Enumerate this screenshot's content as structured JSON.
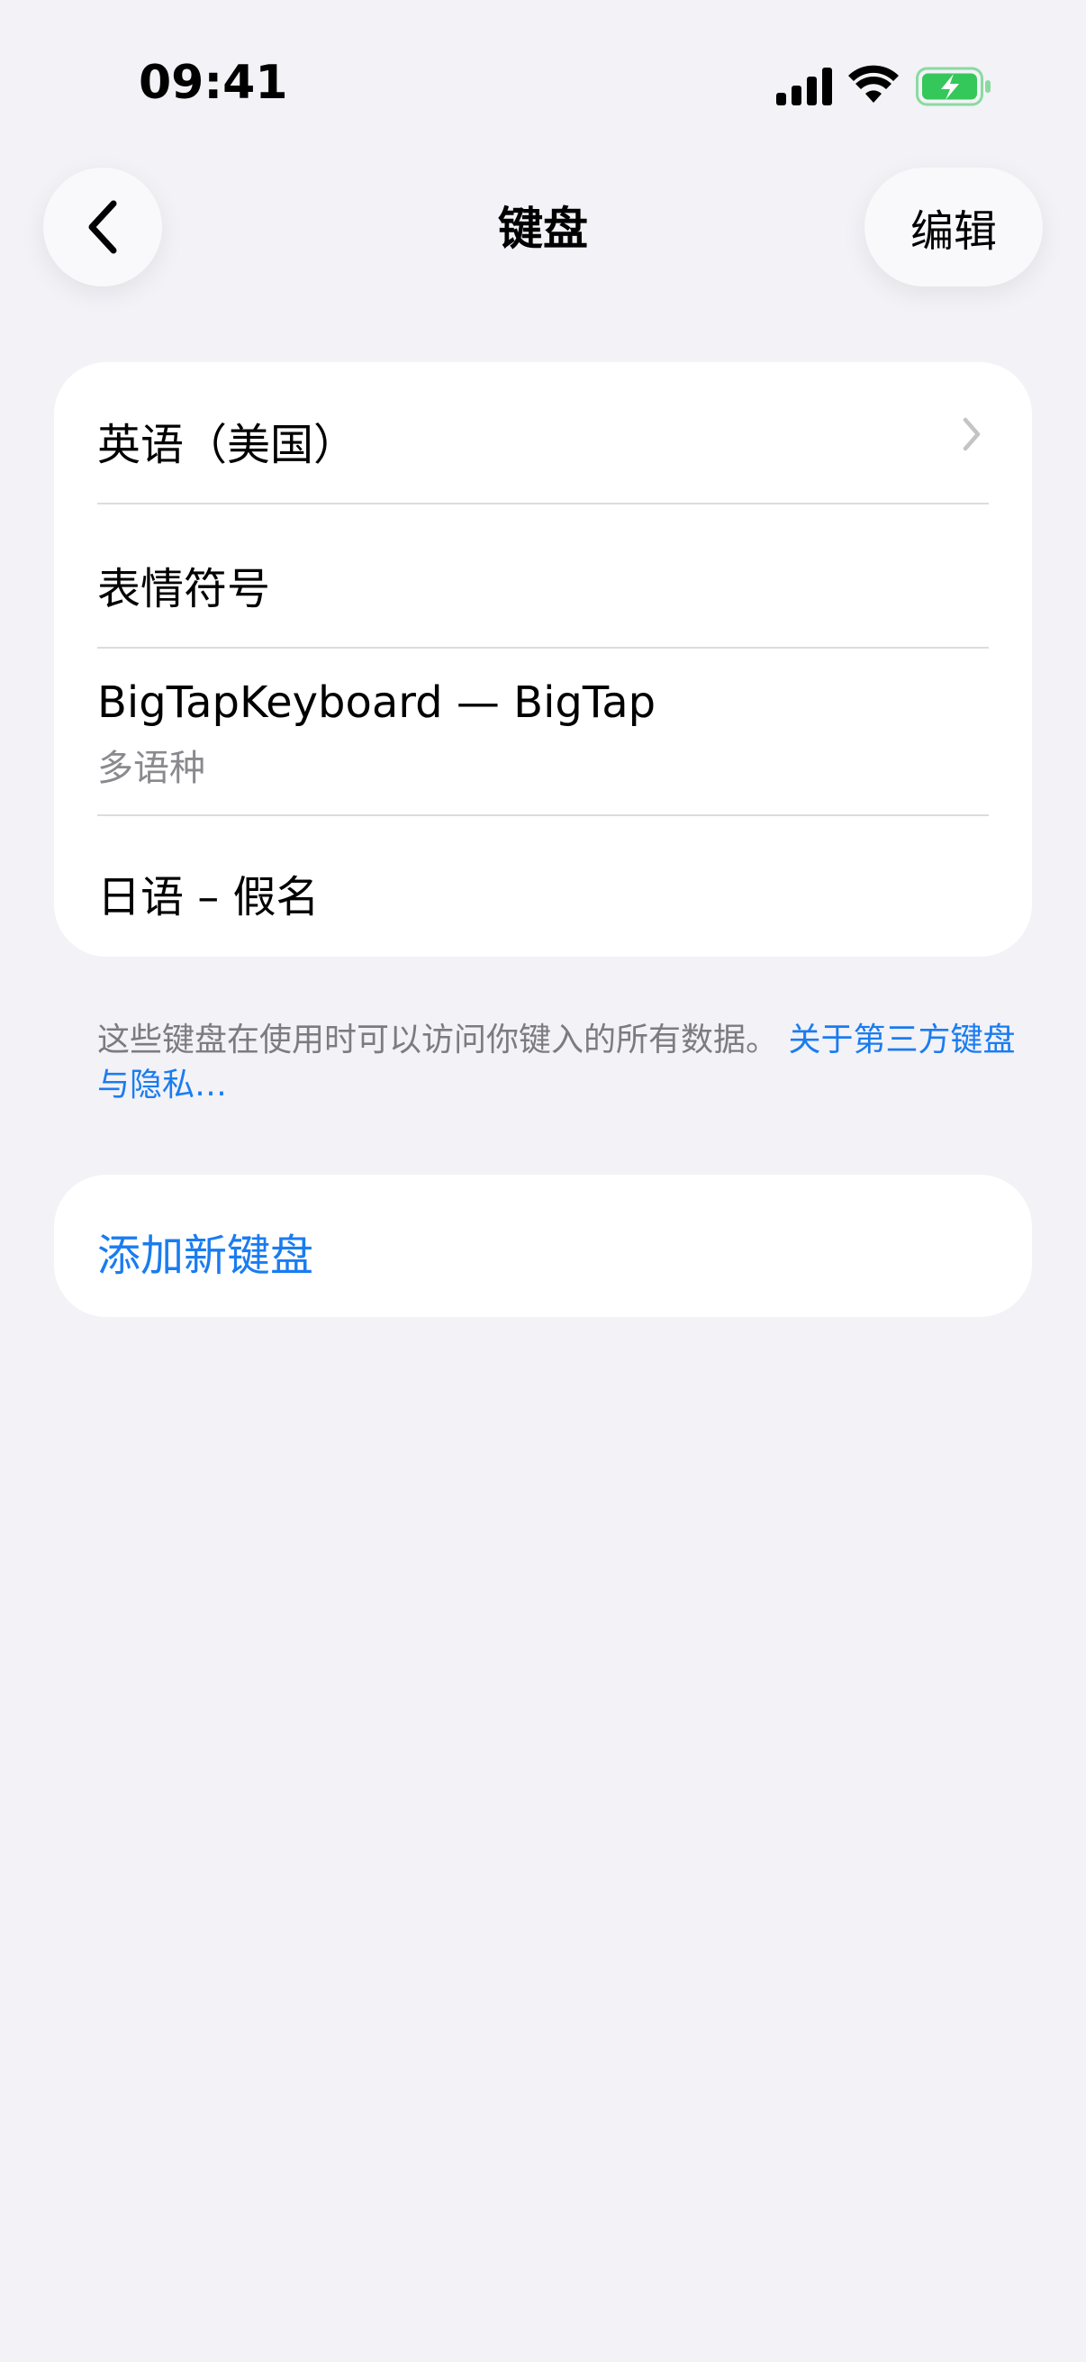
{
  "status_bar": {
    "time": "09:41",
    "icons": [
      "signal-icon",
      "wifi-icon",
      "battery-charging-icon"
    ],
    "battery_color": "#34C759"
  },
  "nav": {
    "title": "键盘",
    "edit_label": "编辑",
    "back_icon": "chevron-left-icon"
  },
  "keyboards": [
    {
      "label": "英语（美国）",
      "has_chevron": true
    },
    {
      "label": "表情符号"
    },
    {
      "label": "BigTapKeyboard — BigTap",
      "sublabel": "多语种"
    },
    {
      "label": "日语 – 假名"
    }
  ],
  "footer": {
    "text": "这些键盘在使用时可以访问你键入的所有数据。",
    "link_text": "关于第三方键盘与隐私…"
  },
  "add_keyboard": {
    "label": "添加新键盘"
  },
  "colors": {
    "background": "#F2F2F7",
    "accent": "#1A7CF0",
    "secondary_text": "#8A8A8E"
  }
}
